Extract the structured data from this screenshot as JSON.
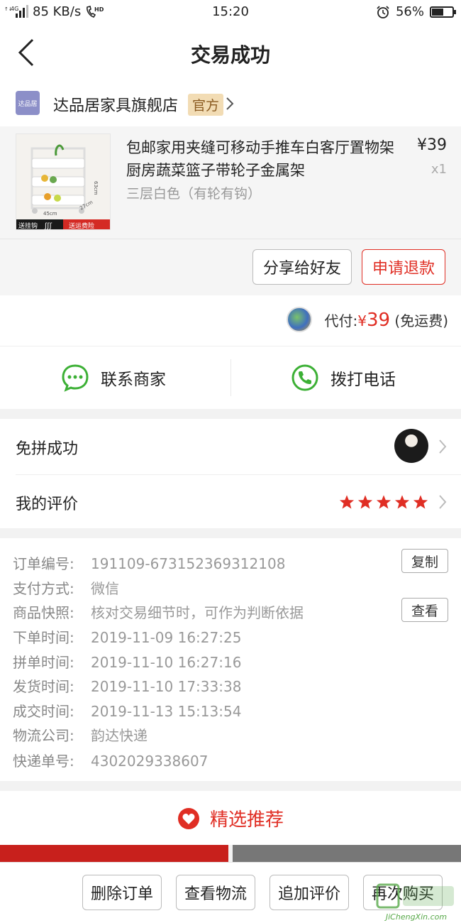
{
  "status_bar": {
    "network": "4G",
    "speed": "85 KB/s",
    "hd": "HD",
    "time": "15:20",
    "battery_text": "56%",
    "battery_level": 0.56
  },
  "nav": {
    "title": "交易成功"
  },
  "shop": {
    "logo_text": "达品居",
    "name": "达品居家具旗舰店",
    "tag": "官方"
  },
  "product": {
    "title": "包邮家用夹缝可移动手推车白客厅置物架厨房蔬菜篮子带轮子金属架",
    "spec": "三层白色（有轮有钩）",
    "price": "¥39",
    "quantity": "x1",
    "thumb_labels": {
      "left": "送挂钩",
      "right": "送运费险",
      "w": "45cm",
      "d": "27cm",
      "h": "63cm"
    }
  },
  "product_actions": {
    "share": "分享给好友",
    "refund": "申请退款"
  },
  "payment": {
    "prefix": "代付:",
    "currency": "¥",
    "amount": "39",
    "note": "(免运费)"
  },
  "contact": {
    "merchant": "联系商家",
    "phone": "拨打电话"
  },
  "group": {
    "label": "免拼成功"
  },
  "review": {
    "label": "我的评价",
    "stars": 5
  },
  "order": {
    "copy_label": "复制",
    "view_label": "查看",
    "rows": [
      {
        "key": "订单编号:",
        "value": "191109-673152369312108"
      },
      {
        "key": "支付方式:",
        "value": "微信"
      },
      {
        "key": "商品快照:",
        "value": "核对交易细节时，可作为判断依据"
      },
      {
        "key": "下单时间:",
        "value": "2019-11-09 16:27:25"
      },
      {
        "key": "拼单时间:",
        "value": "2019-11-10 16:27:16"
      },
      {
        "key": "发货时间:",
        "value": "2019-11-10 17:33:38"
      },
      {
        "key": "成交时间:",
        "value": "2019-11-13 15:13:54"
      },
      {
        "key": "物流公司:",
        "value": "韵达快递"
      },
      {
        "key": "快递单号:",
        "value": "4302029338607"
      }
    ]
  },
  "recommend": {
    "title": "精选推荐"
  },
  "bottom_actions": {
    "delete": "删除订单",
    "logistics": "查看物流",
    "add_review": "追加评价",
    "rebuy": "再次购买"
  },
  "watermark": {
    "site": "JiChengXin.com"
  },
  "colors": {
    "accent_red": "#e02e24",
    "wechat_green": "#3cb035",
    "tag_bg": "#f2dcb4"
  }
}
